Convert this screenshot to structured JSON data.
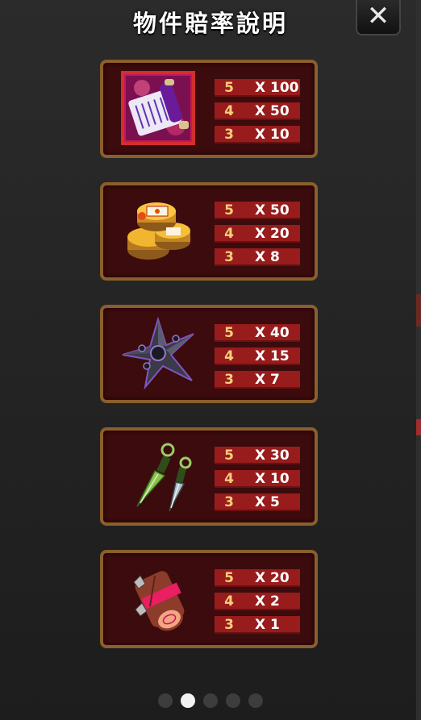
{
  "title": "物件賠率說明",
  "close_label": "✕",
  "items": [
    {
      "icon": "scroll-icon",
      "rows": [
        {
          "count": "5",
          "mult": "X 100"
        },
        {
          "count": "4",
          "mult": "X 50"
        },
        {
          "count": "3",
          "mult": "X 10"
        }
      ]
    },
    {
      "icon": "ration-tins-icon",
      "rows": [
        {
          "count": "5",
          "mult": "X 50"
        },
        {
          "count": "4",
          "mult": "X 20"
        },
        {
          "count": "3",
          "mult": "X 8"
        }
      ]
    },
    {
      "icon": "shuriken-icon",
      "rows": [
        {
          "count": "5",
          "mult": "X 40"
        },
        {
          "count": "4",
          "mult": "X 15"
        },
        {
          "count": "3",
          "mult": "X 7"
        }
      ]
    },
    {
      "icon": "kunai-icon",
      "rows": [
        {
          "count": "5",
          "mult": "X 30"
        },
        {
          "count": "4",
          "mult": "X 10"
        },
        {
          "count": "3",
          "mult": "X 5"
        }
      ]
    },
    {
      "icon": "log-icon",
      "rows": [
        {
          "count": "5",
          "mult": "X 20"
        },
        {
          "count": "4",
          "mult": "X 2"
        },
        {
          "count": "3",
          "mult": "X 1"
        }
      ]
    }
  ],
  "pagination": {
    "total": 5,
    "active_index": 1
  }
}
